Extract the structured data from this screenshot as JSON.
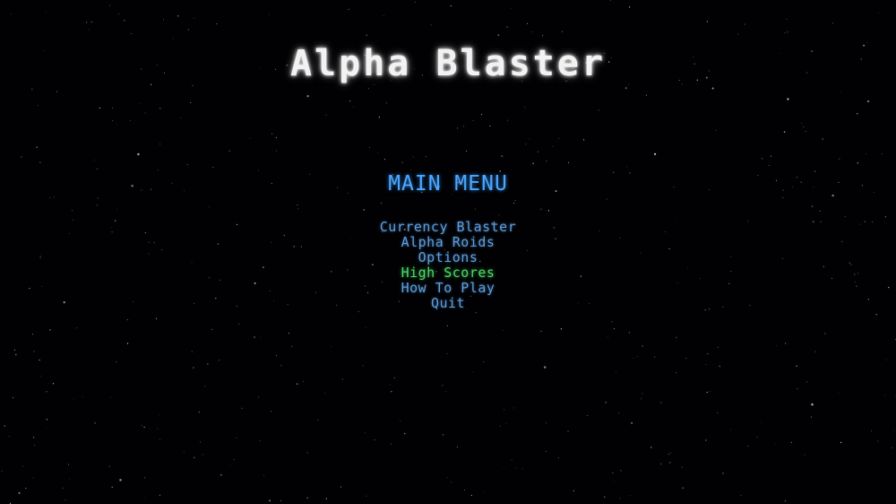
{
  "game": {
    "title": "Alpha Blaster"
  },
  "menu": {
    "heading": "MAIN MENU",
    "items": [
      {
        "label": "Currency Blaster",
        "selected": false
      },
      {
        "label": "Alpha Roids",
        "selected": false
      },
      {
        "label": "Options",
        "selected": false
      },
      {
        "label": "High Scores",
        "selected": true
      },
      {
        "label": "How To Play",
        "selected": false
      },
      {
        "label": "Quit",
        "selected": false
      }
    ]
  },
  "colors": {
    "background": "#010103",
    "title": "#f2f2f2",
    "heading": "#4aa8ff",
    "menu_item": "#5f9ed8",
    "menu_item_selected": "#4fd86a",
    "star": "#cfd6e6"
  }
}
